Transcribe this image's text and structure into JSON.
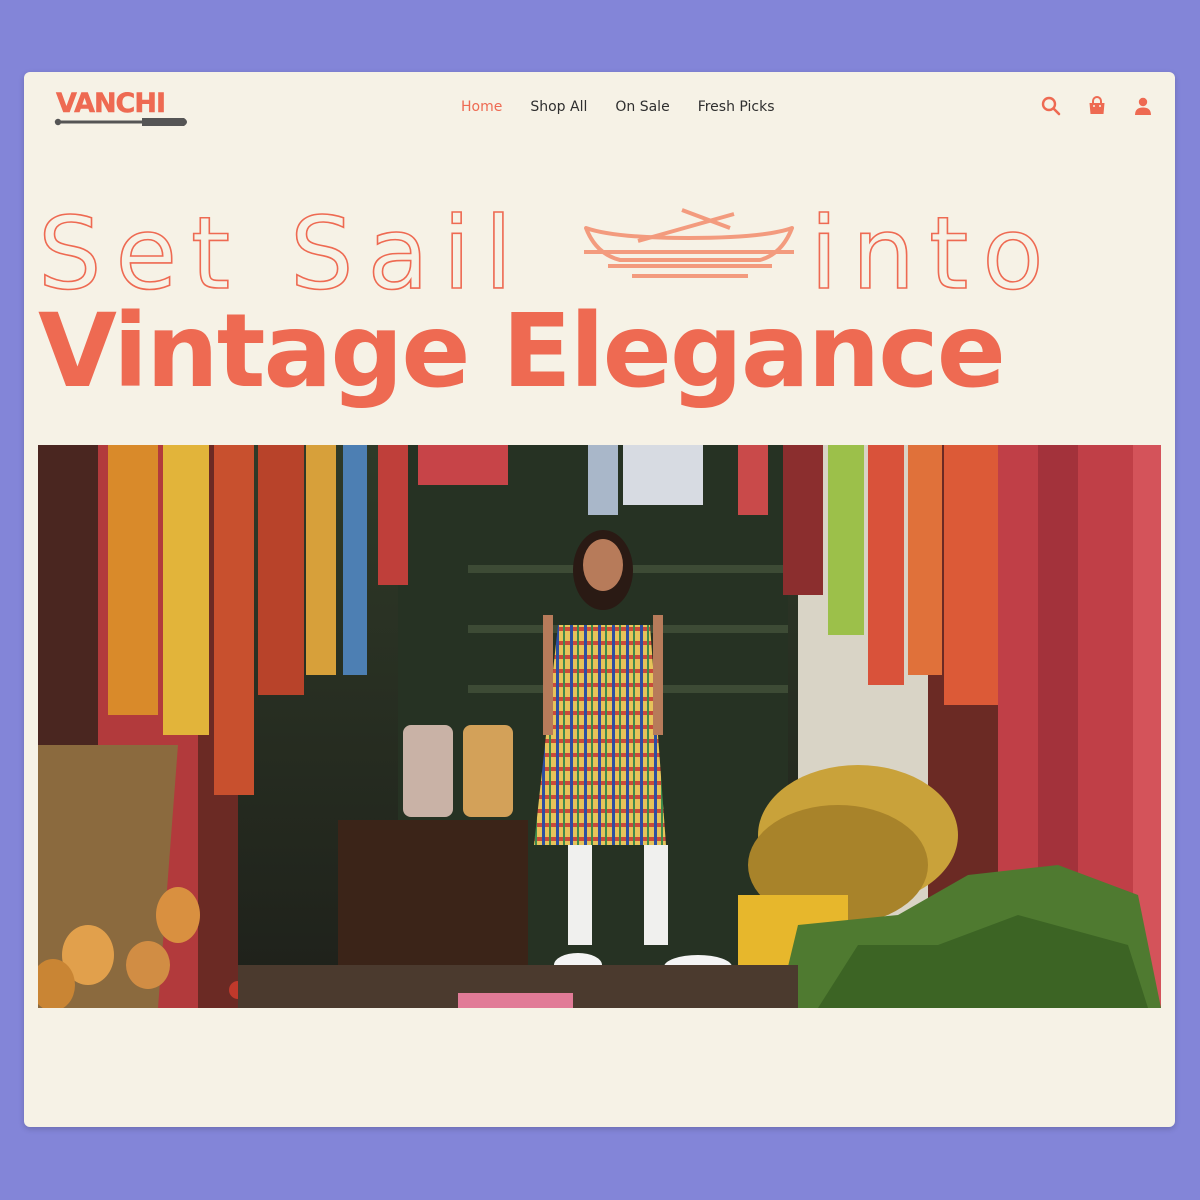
{
  "brand": {
    "name": "VANCHI",
    "accent_color": "#ee6a52",
    "logo_icon": "paddle-icon"
  },
  "nav": {
    "items": [
      {
        "label": "Home",
        "active": true
      },
      {
        "label": "Shop All",
        "active": false
      },
      {
        "label": "On Sale",
        "active": false
      },
      {
        "label": "Fresh Picks",
        "active": false
      }
    ]
  },
  "header_icons": [
    "search-icon",
    "shopping-bag-icon",
    "user-icon"
  ],
  "hero": {
    "headline_outline_part1": "Set Sail",
    "headline_outline_part2": "into",
    "headline_boat_icon": "boat-icon",
    "headline_solid": "Vintage Elegance",
    "image_subject": "street-shop-photo"
  },
  "colors": {
    "page_background": "#8385d8",
    "window_background": "#f6f2e6",
    "nav_text": "#2f2f2f"
  }
}
